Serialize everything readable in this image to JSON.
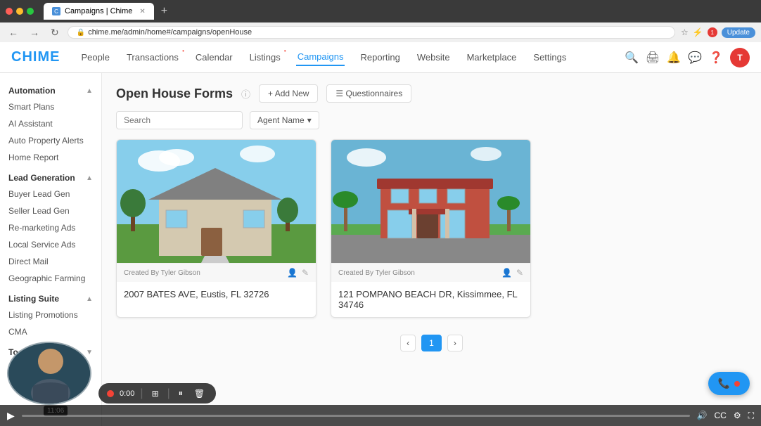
{
  "browser": {
    "tab_label": "Campaigns | Chime",
    "url": "chime.me/admin/home#/campaigns/openHouse",
    "update_btn": "Update"
  },
  "nav": {
    "logo": "CHIME",
    "items": [
      {
        "label": "People",
        "active": false
      },
      {
        "label": "Transactions",
        "active": false,
        "dot": true
      },
      {
        "label": "Calendar",
        "active": false
      },
      {
        "label": "Listings",
        "active": false,
        "dot": true
      },
      {
        "label": "Campaigns",
        "active": true
      },
      {
        "label": "Reporting",
        "active": false
      },
      {
        "label": "Website",
        "active": false
      },
      {
        "label": "Marketplace",
        "active": false
      },
      {
        "label": "Settings",
        "active": false
      }
    ]
  },
  "sidebar": {
    "sections": [
      {
        "title": "Automation",
        "items": [
          "Smart Plans",
          "AI Assistant",
          "Auto Property Alerts",
          "Home Report"
        ]
      },
      {
        "title": "Lead Generation",
        "items": [
          "Buyer Lead Gen",
          "Seller Lead Gen",
          "Re-marketing Ads",
          "Local Service Ads",
          "Direct Mail",
          "Geographic Farming"
        ]
      },
      {
        "title": "Listing Suite",
        "items": [
          "Listing Promotions",
          "CMA"
        ]
      },
      {
        "title": "Tools",
        "items": []
      }
    ]
  },
  "page": {
    "title": "Open House Forms",
    "add_new_label": "+ Add New",
    "questionnaires_label": "☰ Questionnaires",
    "search_placeholder": "Search",
    "agent_filter_label": "Agent Name",
    "cards": [
      {
        "address": "2007 BATES AVE, Eustis, FL 32726",
        "created_by": "Created By Tyler Gibson",
        "bg_color_top": "#8aaa6a",
        "bg_color_bottom": "#5a8a4a"
      },
      {
        "address": "121 POMPANO BEACH DR, Kissimmee, FL 34746",
        "created_by": "Created By Tyler Gibson",
        "bg_color_top": "#c06040",
        "bg_color_bottom": "#4a7a5a"
      }
    ],
    "pagination": {
      "prev": "‹",
      "current": "1",
      "next": "›"
    }
  },
  "video_controls": {
    "timestamp": "11:06",
    "time_display": "0:00"
  },
  "call_button": {
    "icon": "📞"
  }
}
